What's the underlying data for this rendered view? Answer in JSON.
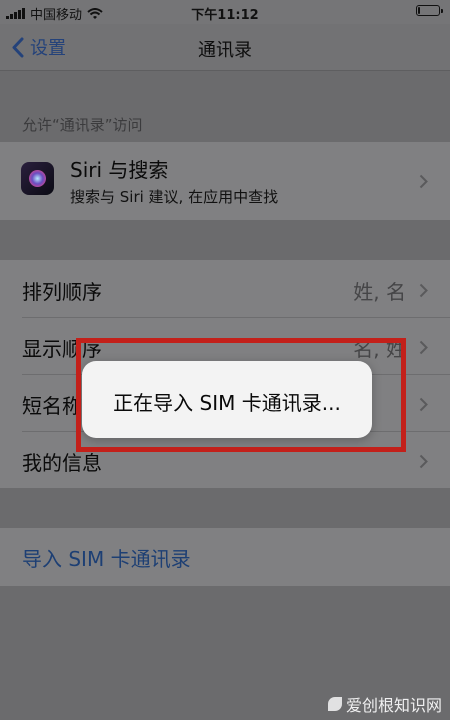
{
  "status_bar": {
    "carrier": "中国移动",
    "time": "下午11:12",
    "battery_level_fraction": 0.12
  },
  "nav": {
    "back_label": "设置",
    "title": "通讯录"
  },
  "section_header": "允许“通讯录”访问",
  "siri": {
    "title": "Siri 与搜索",
    "subtitle": "搜索与 Siri 建议, 在应用中查找"
  },
  "settings_rows": [
    {
      "label": "排列顺序",
      "value": "姓, 名"
    },
    {
      "label": "显示顺序",
      "value": "名, 姓"
    },
    {
      "label": "短名称",
      "value": ""
    },
    {
      "label": "我的信息",
      "value": ""
    }
  ],
  "import_link": "导入 SIM 卡通讯录",
  "hud": {
    "message": "正在导入 SIM 卡通讯录..."
  },
  "watermark": "爱创根知识网",
  "colors": {
    "accent": "#24427a",
    "highlight": "#c3201a"
  }
}
